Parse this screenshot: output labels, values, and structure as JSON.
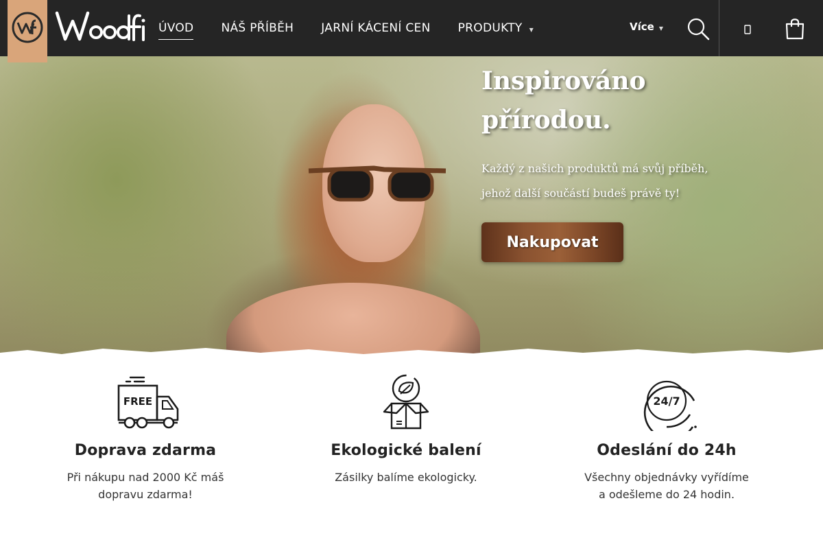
{
  "brand": {
    "name": "Woodfi",
    "accent": "#d9a57a",
    "header_bg": "#252525"
  },
  "nav": {
    "items": [
      {
        "label": "ÚVOD",
        "active": true
      },
      {
        "label": "NÁŠ PŘÍBĚH",
        "active": false
      },
      {
        "label": "JARNÍ KÁCENÍ CEN",
        "active": false
      },
      {
        "label": "PRODUKTY",
        "active": false,
        "has_dropdown": true
      }
    ],
    "more_label": "Více",
    "icons": {
      "search": "search-icon",
      "user": "user-icon",
      "cart": "shopping-bag-icon",
      "dropdown": "caret-down-icon"
    }
  },
  "hero": {
    "title_line1": "Inspirováno",
    "title_line2": "přírodou.",
    "subtitle_line1": "Každý z našich produktů má svůj příběh,",
    "subtitle_line2": "jehož další součástí budeš právě ty!",
    "cta_label": "Nakupovat"
  },
  "features": [
    {
      "icon": "free-delivery-truck-icon",
      "title": "Doprava zdarma",
      "desc_line1": "Při nákupu nad 2000 Kč máš",
      "desc_line2": "dopravu zdarma!",
      "icon_text": "FREE"
    },
    {
      "icon": "eco-packaging-box-icon",
      "title": "Ekologické balení",
      "desc_line1": "Zásilky balíme ekologicky.",
      "desc_line2": ""
    },
    {
      "icon": "clock-24-7-icon",
      "title": "Odeslání do 24h",
      "desc_line1": "Všechny objednávky vyřídíme",
      "desc_line2": "a odešleme do 24 hodin.",
      "icon_text": "24/7"
    }
  ]
}
